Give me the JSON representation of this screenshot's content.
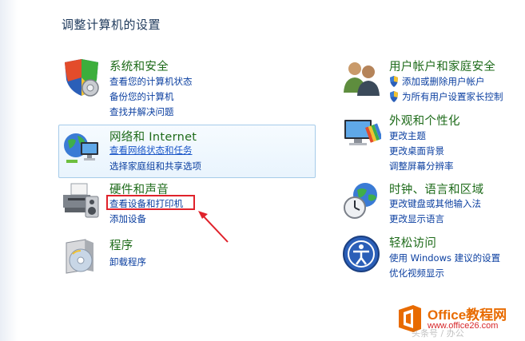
{
  "page_title": "调整计算机的设置",
  "categories": {
    "system": {
      "title": "系统和安全",
      "links": [
        "查看您的计算机状态",
        "备份您的计算机",
        "查找并解决问题"
      ]
    },
    "user": {
      "title": "用户帐户和家庭安全",
      "links": [
        "添加或删除用户帐户",
        "为所有用户设置家长控制"
      ]
    },
    "network": {
      "title": "网络和 Internet",
      "links": [
        "查看网络状态和任务",
        "选择家庭组和共享选项"
      ]
    },
    "appearance": {
      "title": "外观和个性化",
      "links": [
        "更改主题",
        "更改桌面背景",
        "调整屏幕分辨率"
      ]
    },
    "hardware": {
      "title": "硬件和声音",
      "links": [
        "查看设备和打印机",
        "添加设备"
      ]
    },
    "clock": {
      "title": "时钟、语言和区域",
      "links": [
        "更改键盘或其他输入法",
        "更改显示语言"
      ]
    },
    "programs": {
      "title": "程序",
      "links": [
        "卸载程序"
      ]
    },
    "ease": {
      "title": "轻松访问",
      "links": [
        "使用 Windows 建议的设置",
        "优化视频显示"
      ]
    }
  },
  "watermark": {
    "name": "Office教程网",
    "url": "www.office26.com",
    "faint": "头条号 / 办公"
  },
  "colors": {
    "title_green": "#1e6b1a",
    "link_blue": "#0b3fa0",
    "highlight_red": "#e0222b",
    "brand_orange": "#e86b00"
  }
}
